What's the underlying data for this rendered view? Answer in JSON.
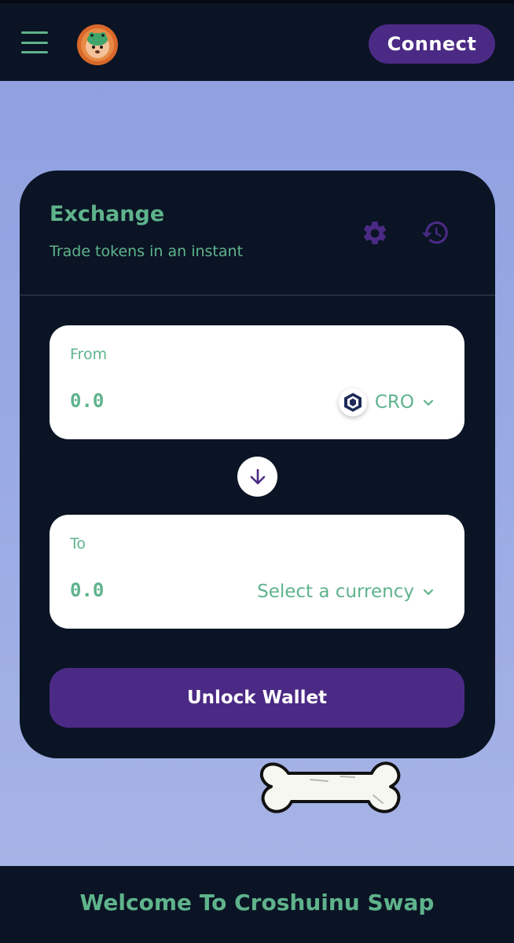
{
  "header": {
    "menu_icon": "hamburger-menu-icon",
    "logo_icon": "croshuinu-logo",
    "connect_label": "Connect"
  },
  "exchange": {
    "title": "Exchange",
    "subtitle": "Trade tokens in an instant",
    "settings_icon": "gear-icon",
    "history_icon": "history-icon",
    "from": {
      "label": "From",
      "amount": "0.0",
      "currency": "CRO",
      "currency_icon": "cro-token-icon"
    },
    "swap_icon": "arrow-down-icon",
    "to": {
      "label": "To",
      "amount": "0.0",
      "currency": "Select a currency"
    },
    "unlock_label": "Unlock Wallet"
  },
  "decoration": {
    "bone_icon": "bone-icon"
  },
  "footer": {
    "text": "Welcome To Croshuinu Swap"
  },
  "colors": {
    "background": "#9aaae3",
    "dark": "#0a1424",
    "accent_green": "#5fb38c",
    "accent_purple": "#4b2a85"
  }
}
